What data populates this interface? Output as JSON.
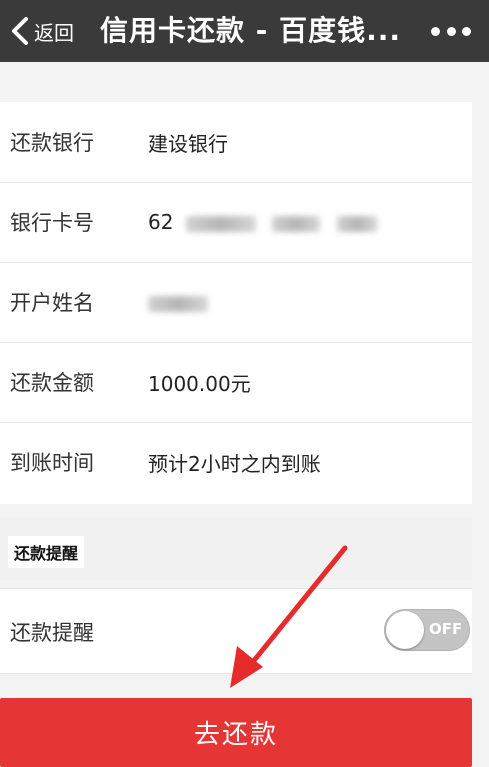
{
  "topbar": {
    "back_label": "返回",
    "title": "信用卡还款 - 百度钱...",
    "more_icon": "more-dots-icon"
  },
  "details": {
    "rows": [
      {
        "label": "还款银行",
        "value": "建设银行"
      },
      {
        "label": "银行卡号",
        "value": "62"
      },
      {
        "label": "开户姓名",
        "value": ""
      },
      {
        "label": "还款金额",
        "value": "1000.00元"
      },
      {
        "label": "到账时间",
        "value": "预计2小时之内到账"
      }
    ]
  },
  "reminder": {
    "section_title": "还款提醒",
    "row_label": "还款提醒",
    "toggle_text": "OFF",
    "toggle_on": false
  },
  "actions": {
    "pay_label": "去还款"
  },
  "colors": {
    "topbar": "#3a3a3a",
    "pay_button": "#e53535",
    "arrow": "#e52b2b"
  }
}
